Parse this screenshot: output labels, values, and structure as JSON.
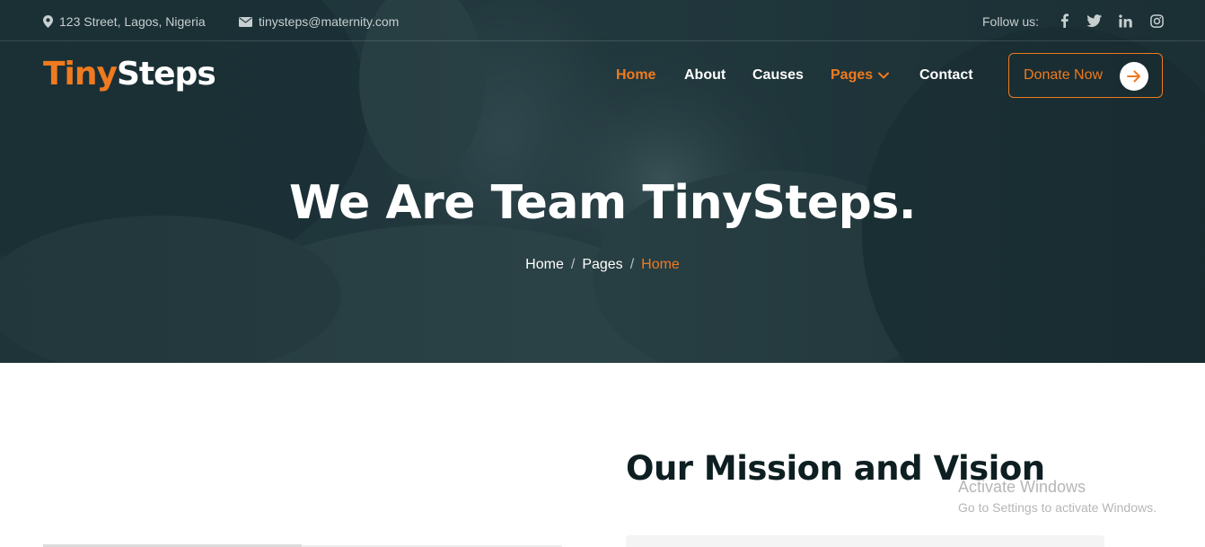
{
  "topbar": {
    "address": "123 Street, Lagos, Nigeria",
    "email": "tinysteps@maternity.com",
    "follow_label": "Follow us:",
    "social_icons": [
      "facebook-icon",
      "twitter-icon",
      "linkedin-icon",
      "instagram-icon"
    ]
  },
  "brand": {
    "logo_part1": "Tiny",
    "logo_part2": "Steps"
  },
  "nav": {
    "items": [
      {
        "label": "Home",
        "active": true
      },
      {
        "label": "About",
        "active": false
      },
      {
        "label": "Causes",
        "active": false
      },
      {
        "label": "Pages",
        "active": true,
        "dropdown": true
      },
      {
        "label": "Contact",
        "active": false
      }
    ],
    "donate_label": "Donate Now"
  },
  "hero": {
    "title": "We Are Team TinySteps.",
    "breadcrumb": [
      "Home",
      "Pages",
      "Home"
    ]
  },
  "content": {
    "section_title": "Our Mission and Vision"
  },
  "watermark": {
    "title": "Activate Windows",
    "subtitle": "Go to Settings to activate Windows."
  },
  "colors": {
    "accent": "#f07a1f",
    "hero_bg": "#1d3338",
    "heading": "#0e1f22"
  }
}
